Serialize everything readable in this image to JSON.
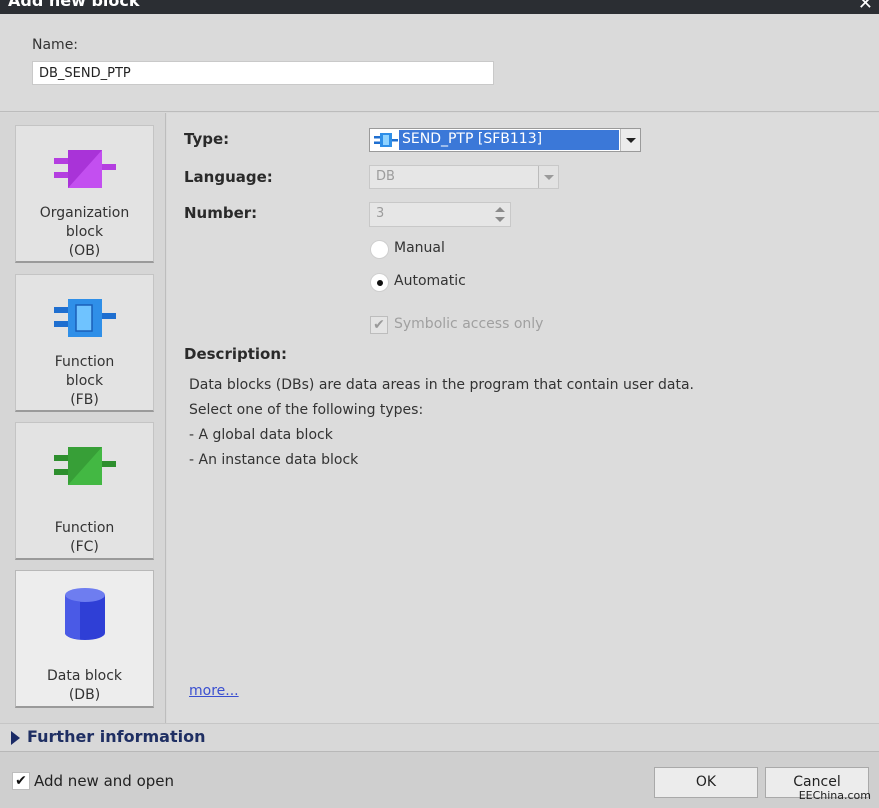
{
  "window": {
    "title": "Add new block"
  },
  "name_section": {
    "label": "Name:",
    "value": "DB_SEND_PTP"
  },
  "blocks": [
    {
      "label_lines": [
        "Organization",
        "block",
        "(OB)"
      ],
      "icon": "organization-block-icon",
      "color": "#b43ee0"
    },
    {
      "label_lines": [
        "Function",
        "block",
        "(FB)"
      ],
      "icon": "function-block-icon",
      "color": "#2f8fe8"
    },
    {
      "label_lines": [
        "Function",
        "(FC)"
      ],
      "icon": "function-icon",
      "color": "#3aa83a"
    },
    {
      "label_lines": [
        "Data block",
        "(DB)"
      ],
      "icon": "data-block-icon",
      "color": "#3b4de0",
      "selected": true
    }
  ],
  "form": {
    "type_label": "Type:",
    "type_value": "SEND_PTP  [SFB113]",
    "language_label": "Language:",
    "language_value": "DB",
    "number_label": "Number:",
    "number_value": "3",
    "radio_manual": "Manual",
    "radio_automatic": "Automatic",
    "symbolic_label": "Symbolic access only",
    "description_title": "Description:",
    "description_lines": [
      "Data blocks (DBs) are data areas in the program that contain user data.",
      "Select one of the following types:",
      "- A global data block",
      "- An instance data block"
    ],
    "more_link": "more..."
  },
  "further_info": {
    "label": "Further information"
  },
  "footer": {
    "add_open_label": "Add new and open",
    "ok_label": "OK",
    "cancel_label": "Cancel",
    "watermark": "EEChina.com"
  }
}
